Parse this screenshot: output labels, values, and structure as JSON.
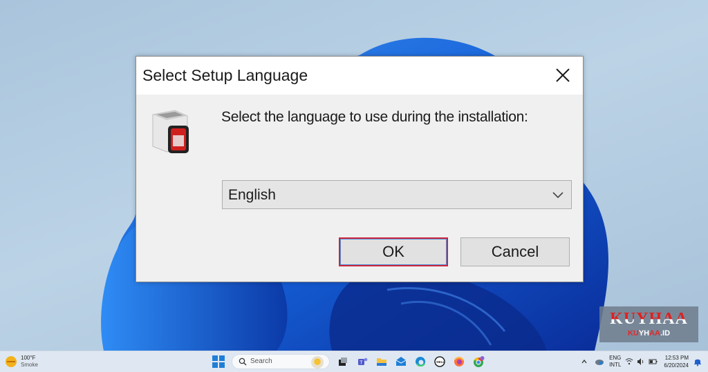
{
  "dialog": {
    "title": "Select Setup Language",
    "close_icon": "close-icon",
    "app_icon": "installer-box-icon",
    "prompt": "Select the language to use during the installation:",
    "language_select": {
      "selected": "English",
      "icon": "chevron-down-icon"
    },
    "buttons": {
      "ok": "OK",
      "cancel": "Cancel"
    },
    "colors": {
      "focus_border": "#d0243a",
      "body": "#f0f0f0",
      "titlebar": "#ffffff"
    }
  },
  "watermark": {
    "title": "KUYHAA",
    "subtitle_parts": [
      "KU",
      "YH",
      "AA",
      ".ID"
    ]
  },
  "taskbar": {
    "weather": {
      "temperature": "100°F",
      "condition": "Smoke",
      "icon": "weather-smoke-icon"
    },
    "start_icon": "windows-start-icon",
    "search": {
      "placeholder": "Search",
      "icon": "search-icon"
    },
    "pinned_apps": [
      {
        "name": "task-view-icon"
      },
      {
        "name": "teams-icon"
      },
      {
        "name": "file-explorer-icon"
      },
      {
        "name": "mail-icon"
      },
      {
        "name": "edge-icon"
      },
      {
        "name": "dell-icon"
      },
      {
        "name": "firefox-icon"
      },
      {
        "name": "chrome-icon"
      }
    ],
    "tray": {
      "chevron_icon": "chevron-up-icon",
      "onedrive_icon": "onedrive-icon",
      "language_line1": "ENG",
      "language_line2": "INTL",
      "wifi_icon": "wifi-icon",
      "volume_icon": "volume-icon",
      "battery_icon": "battery-icon",
      "time": "12:53 PM",
      "date": "6/20/2024",
      "notification_icon": "notification-bell-icon"
    }
  }
}
